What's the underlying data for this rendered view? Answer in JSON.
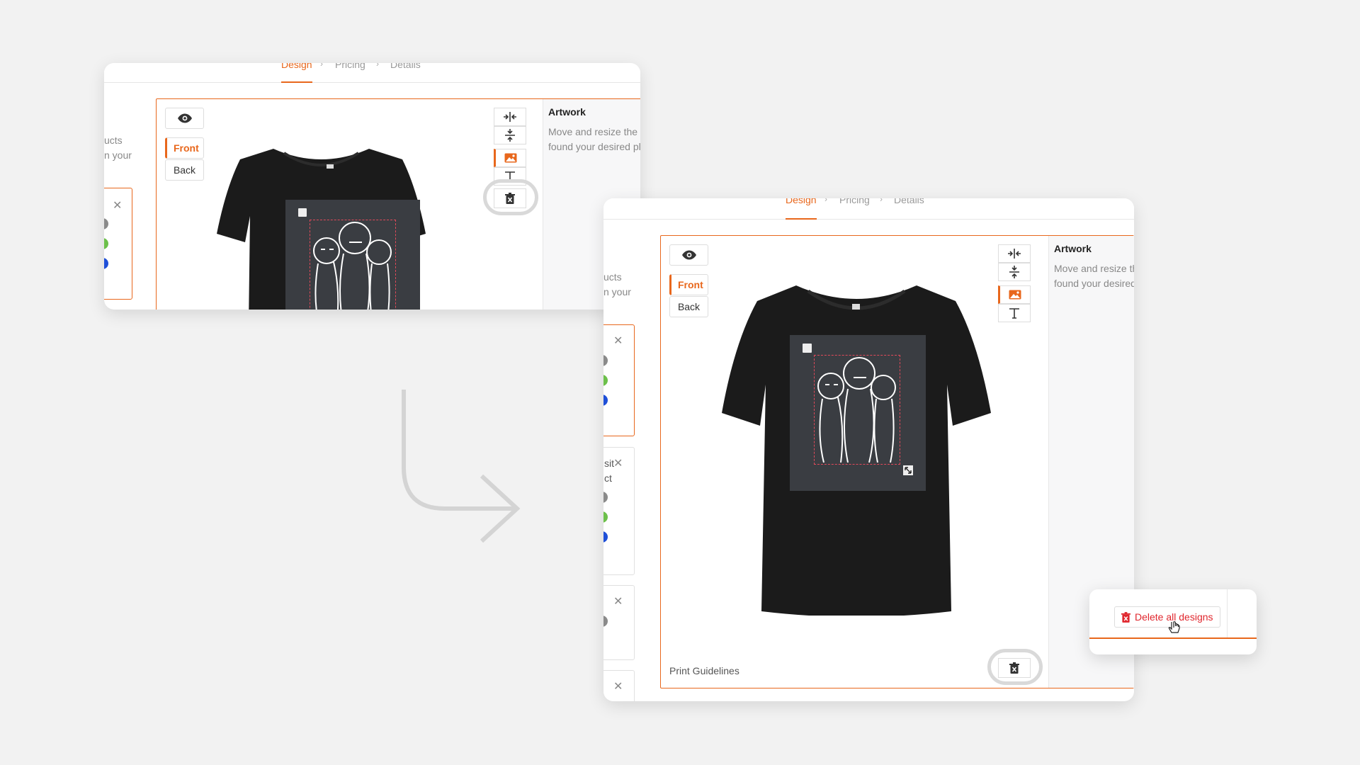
{
  "steps": {
    "design": "Design",
    "pricing": "Pricing",
    "details": "Details"
  },
  "side_tabs": {
    "front": "Front",
    "back": "Back"
  },
  "artwork": {
    "title": "Artwork",
    "desc_line1": "Move and resize the",
    "desc_line2": "found your desired pl"
  },
  "artwork_right": {
    "title": "Artwork",
    "desc_line1": "Move and resize th",
    "desc_line2": "found your desired"
  },
  "left_fragments": {
    "line1": "ucts",
    "line2": "n your",
    "line3": "sit",
    "line4": "ct"
  },
  "print_guidelines": "Print Guidelines",
  "tooltip": {
    "delete_label": "Delete all designs"
  },
  "colors": {
    "accent": "#e8671c",
    "gray": "#8a8a8a",
    "green": "#6cc04a",
    "blue": "#1e4fd8",
    "danger": "#e0262d",
    "shirt": "#1b1b1b"
  },
  "icons": [
    "eye-icon",
    "align-horizontal-icon",
    "align-vertical-icon",
    "image-icon",
    "text-icon",
    "trash-icon",
    "close-icon",
    "resize-icon",
    "arrow-icon",
    "cursor-icon"
  ]
}
